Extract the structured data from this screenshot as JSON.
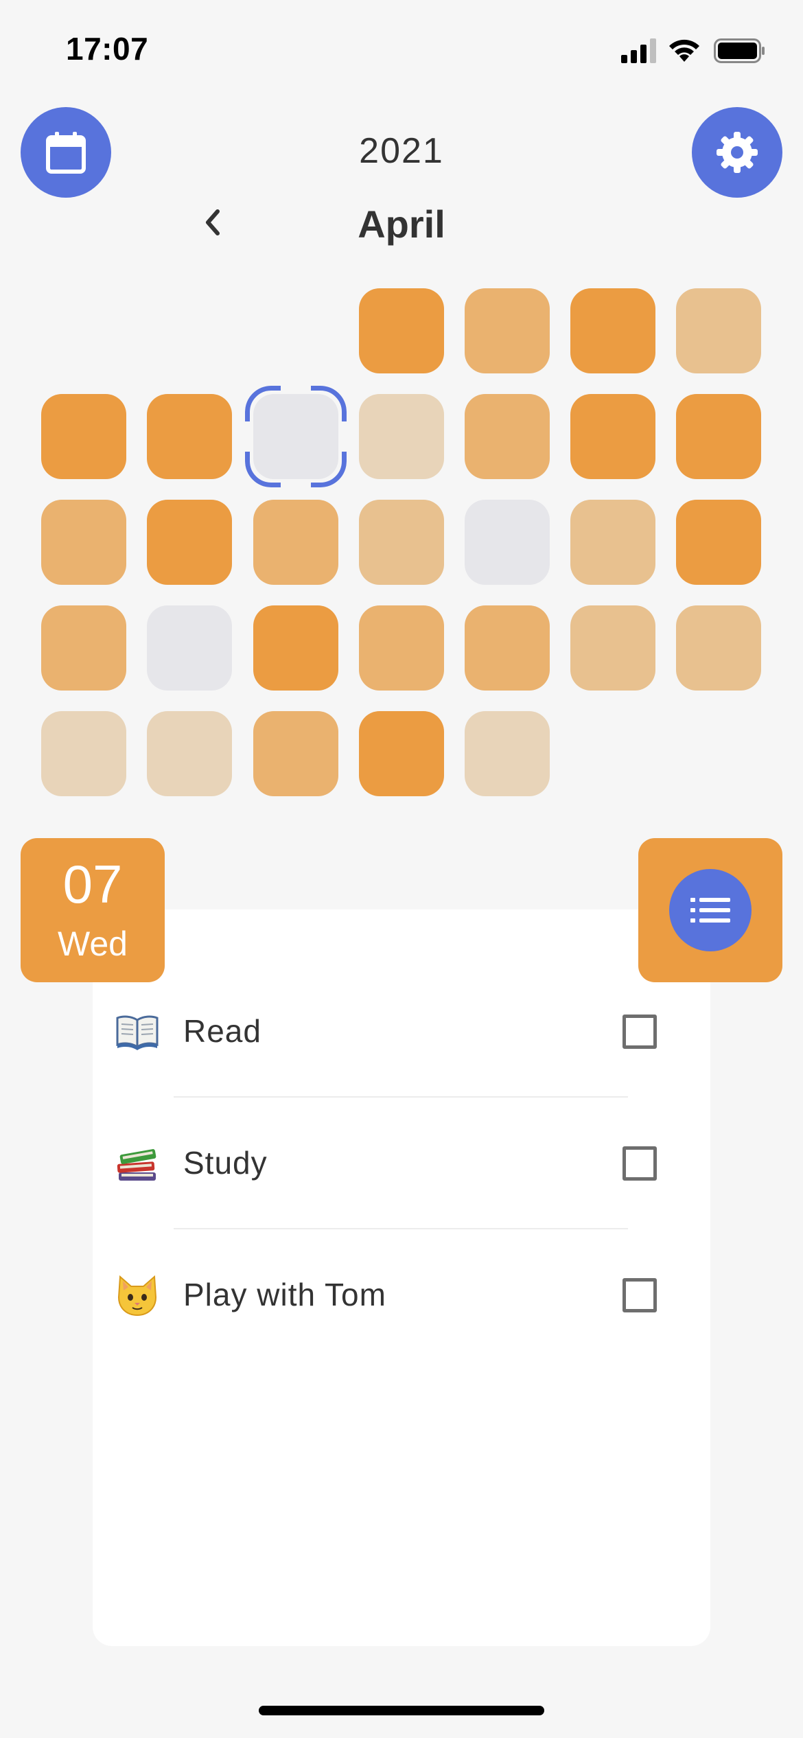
{
  "status_bar": {
    "time": "17:07",
    "icons": [
      "signal-icon",
      "wifi-icon",
      "battery-icon"
    ]
  },
  "header": {
    "year": "2021",
    "month": "April",
    "left_button_icon": "calendar-icon",
    "right_button_icon": "gear-icon",
    "prev_icon": "chevron-left-icon"
  },
  "calendar": {
    "leading_blank_days": 3,
    "intensity_colors": {
      "dark": "#eb9c42",
      "medium": "#eab26f",
      "light": "#e8c18f",
      "pale": "#e8d4b9",
      "empty": "#e6e6ea"
    },
    "days": [
      {
        "day": 1,
        "level": "dark"
      },
      {
        "day": 2,
        "level": "medium"
      },
      {
        "day": 3,
        "level": "dark"
      },
      {
        "day": 4,
        "level": "light"
      },
      {
        "day": 5,
        "level": "dark"
      },
      {
        "day": 6,
        "level": "dark"
      },
      {
        "day": 7,
        "level": "empty",
        "selected": true
      },
      {
        "day": 8,
        "level": "pale"
      },
      {
        "day": 9,
        "level": "medium"
      },
      {
        "day": 10,
        "level": "dark"
      },
      {
        "day": 11,
        "level": "dark"
      },
      {
        "day": 12,
        "level": "medium"
      },
      {
        "day": 13,
        "level": "dark"
      },
      {
        "day": 14,
        "level": "medium"
      },
      {
        "day": 15,
        "level": "light"
      },
      {
        "day": 16,
        "level": "empty"
      },
      {
        "day": 17,
        "level": "light"
      },
      {
        "day": 18,
        "level": "dark"
      },
      {
        "day": 19,
        "level": "medium"
      },
      {
        "day": 20,
        "level": "empty"
      },
      {
        "day": 21,
        "level": "dark"
      },
      {
        "day": 22,
        "level": "medium"
      },
      {
        "day": 23,
        "level": "medium"
      },
      {
        "day": 24,
        "level": "light"
      },
      {
        "day": 25,
        "level": "light"
      },
      {
        "day": 26,
        "level": "pale"
      },
      {
        "day": 27,
        "level": "pale"
      },
      {
        "day": 28,
        "level": "medium"
      },
      {
        "day": 29,
        "level": "dark"
      },
      {
        "day": 30,
        "level": "pale"
      }
    ]
  },
  "selected_date": {
    "day": "07",
    "weekday": "Wed"
  },
  "list_button_icon": "list-icon",
  "tasks": [
    {
      "emoji": "open-book-icon",
      "label": "Read",
      "checked": false
    },
    {
      "emoji": "books-icon",
      "label": "Study",
      "checked": false
    },
    {
      "emoji": "cat-face-icon",
      "label": "Play with Tom",
      "checked": false
    }
  ],
  "colors": {
    "accent_blue": "#5873dc",
    "accent_orange": "#eb9c42",
    "background": "#f6f6f6"
  }
}
